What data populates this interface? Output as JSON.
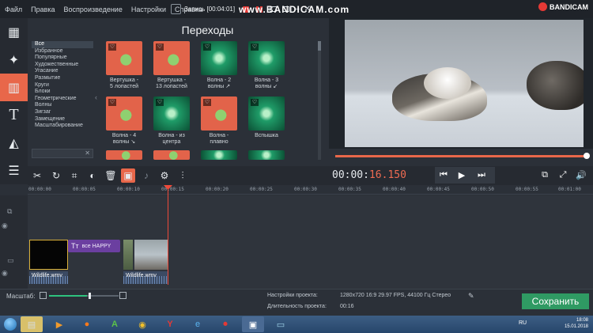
{
  "titlebar": {
    "menu": [
      "Файл",
      "Правка",
      "Воспроизведение",
      "Настройки",
      "Справка"
    ],
    "recording_text": "Запись [00:04:01]",
    "watermark": "www.BANDICAM.com",
    "bandicam_logo": "BANDICAM"
  },
  "sidebar": {
    "tools": [
      {
        "icon": "film-icon"
      },
      {
        "icon": "magic-wand-icon"
      },
      {
        "icon": "transitions-icon",
        "active": true
      },
      {
        "icon": "text-icon"
      },
      {
        "icon": "shapes-icon"
      },
      {
        "icon": "list-icon"
      }
    ]
  },
  "transitions": {
    "title": "Переходы",
    "categories": [
      "Все",
      "Избранное",
      "Популярные",
      "Художественные",
      "Угасание",
      "Размытие",
      "Круги",
      "Блоки",
      "Геометрические",
      "Волны",
      "Зигзаг",
      "Замещение",
      "Масштабирование"
    ],
    "selected_category": "Все",
    "items": [
      {
        "label1": "Вертушка -",
        "label2": "5 лопастей",
        "style": "red"
      },
      {
        "label1": "Вертушка -",
        "label2": "13 лопастей",
        "style": "red"
      },
      {
        "label1": "Волна - 2",
        "label2": "волны ↗",
        "style": "green"
      },
      {
        "label1": "Волна - 3",
        "label2": "волны ↙",
        "style": "green"
      },
      {
        "label1": "Волна - 4",
        "label2": "волны ↘",
        "style": "red"
      },
      {
        "label1": "Волна - из",
        "label2": "центра",
        "style": "green"
      },
      {
        "label1": "Волна -",
        "label2": "плавно",
        "style": "red"
      },
      {
        "label1": "Вспышка",
        "label2": "",
        "style": "green"
      }
    ]
  },
  "player": {
    "timecode_a": "00:00:",
    "timecode_b": "16.150",
    "progress": 1.0
  },
  "ruler": {
    "ticks": [
      "00:00:00",
      "00:00:05",
      "00:00:10",
      "00:00:15",
      "00:00:20",
      "00:00:25",
      "00:00:30",
      "00:00:35",
      "00:00:40",
      "00:00:45",
      "00:00:50",
      "00:00:55",
      "00:01:00"
    ]
  },
  "timeline": {
    "title_clip": {
      "icon_text": "Tт",
      "label": "все HAPPY"
    },
    "audio_clips": [
      {
        "label": "Wildlife.wmv"
      },
      {
        "label": "Wildlife.wmv"
      }
    ]
  },
  "status": {
    "scale_label": "Масштаб:",
    "zoom_level": 0.55,
    "project_settings_label": "Настройки проекта:",
    "project_settings_value": "1280x720 16:9 29.97 FPS, 44100 Гц Стерео",
    "duration_label": "Длительность проекта:",
    "duration_value": "00:16",
    "save_button": "Сохранить"
  },
  "taskbar": {
    "lang": "RU",
    "time": "18:08",
    "date": "15.01.2018"
  }
}
